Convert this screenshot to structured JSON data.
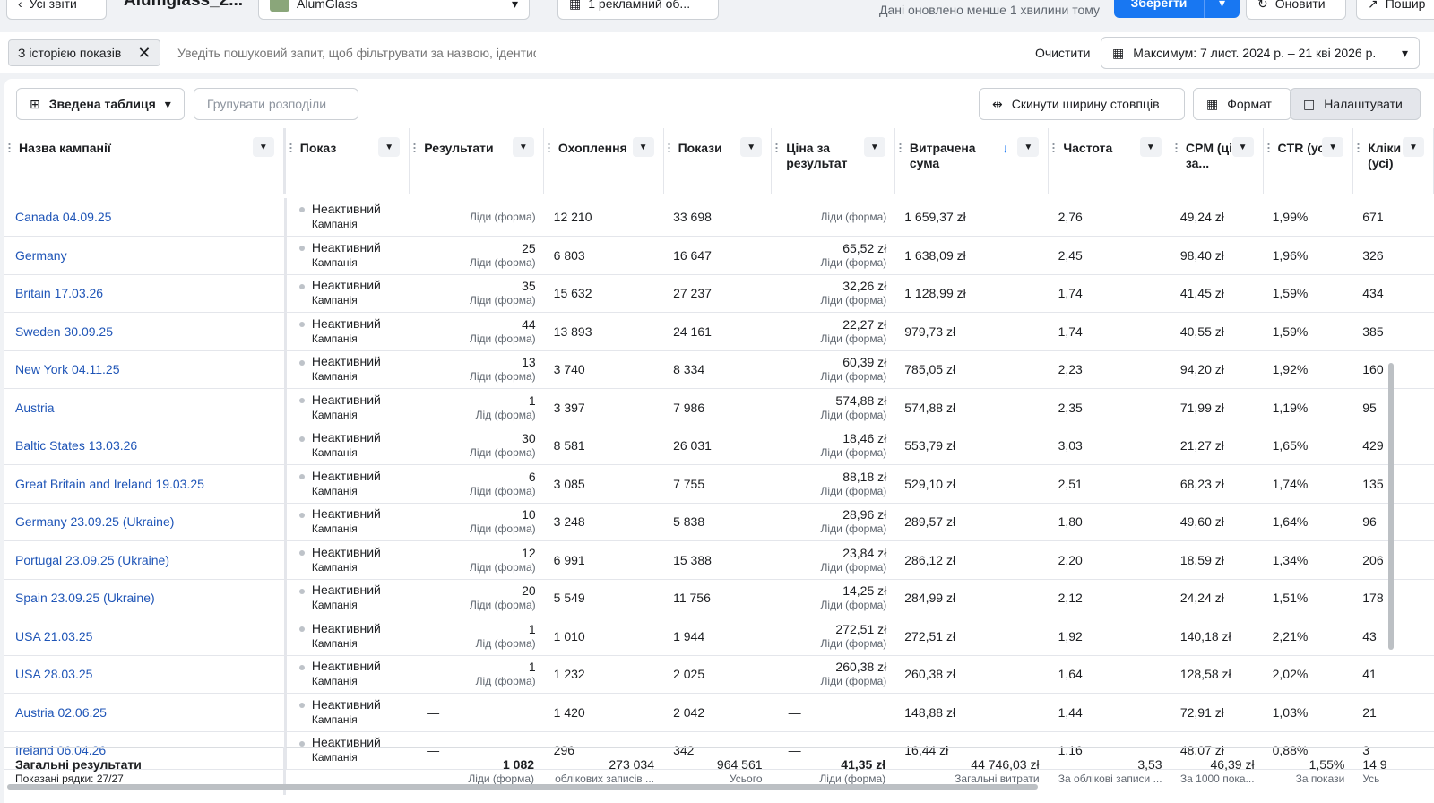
{
  "topbar": {
    "back_label": "Усі звіти",
    "report_title": "Alumglass_2...",
    "account": "AlumGlass",
    "campaigns_selector": "1 рекламний об...",
    "updated_text": "Дані оновлено менше 1 хвилини тому",
    "save_label": "Зберегти",
    "refresh_label": "Оновити",
    "share_label": "Пошир"
  },
  "filters": {
    "chip_label": "З історією показів",
    "search_placeholder": "Уведіть пошуковий запит, щоб фільтрувати за назвою, ідентифікатором або метрикою",
    "clear_label": "Очистити",
    "date_range": "Максимум: 7 лист. 2024 р. – 21 кві 2026 р."
  },
  "toolbar": {
    "pivot_label": "Зведена таблиця",
    "group_label": "Групувати розподіли",
    "reset_width_label": "Скинути ширину стовпців",
    "format_label": "Формат",
    "customize_label": "Налаштувати"
  },
  "columns": [
    {
      "label": "Назва кампанії"
    },
    {
      "label": "Показ"
    },
    {
      "label": "Результати"
    },
    {
      "label": "Охоплення"
    },
    {
      "label": "Покази"
    },
    {
      "label": "Ціна за результат"
    },
    {
      "label": "Витрачена сума",
      "sort_icon": "↓"
    },
    {
      "label": "Частота"
    },
    {
      "label": "CPM (ціна за..."
    },
    {
      "label": "CTR (усі)"
    },
    {
      "label": "Кліки (усі)"
    }
  ],
  "rows": [
    {
      "name": "Canada 04.09.25",
      "status": "Неактивний",
      "type": "Кампанія",
      "results": "",
      "results_unit": "Ліди (форма)",
      "reach": "12 210",
      "impressions": "33 698",
      "cpr": "",
      "cpr_unit": "Ліди (форма)",
      "spent": "1 659,37 zł",
      "freq": "2,76",
      "cpm": "49,24 zł",
      "ctr": "1,99%",
      "clicks": "671"
    },
    {
      "name": "Germany",
      "status": "Неактивний",
      "type": "Кампанія",
      "results": "25",
      "results_unit": "Ліди (форма)",
      "reach": "6 803",
      "impressions": "16 647",
      "cpr": "65,52 zł",
      "cpr_unit": "Ліди (форма)",
      "spent": "1 638,09 zł",
      "freq": "2,45",
      "cpm": "98,40 zł",
      "ctr": "1,96%",
      "clicks": "326"
    },
    {
      "name": "Britain 17.03.26",
      "status": "Неактивний",
      "type": "Кампанія",
      "results": "35",
      "results_unit": "Ліди (форма)",
      "reach": "15 632",
      "impressions": "27 237",
      "cpr": "32,26 zł",
      "cpr_unit": "Ліди (форма)",
      "spent": "1 128,99 zł",
      "freq": "1,74",
      "cpm": "41,45 zł",
      "ctr": "1,59%",
      "clicks": "434"
    },
    {
      "name": "Sweden 30.09.25",
      "status": "Неактивний",
      "type": "Кампанія",
      "results": "44",
      "results_unit": "Ліди (форма)",
      "reach": "13 893",
      "impressions": "24 161",
      "cpr": "22,27 zł",
      "cpr_unit": "Ліди (форма)",
      "spent": "979,73 zł",
      "freq": "1,74",
      "cpm": "40,55 zł",
      "ctr": "1,59%",
      "clicks": "385"
    },
    {
      "name": "New York 04.11.25",
      "status": "Неактивний",
      "type": "Кампанія",
      "results": "13",
      "results_unit": "Ліди (форма)",
      "reach": "3 740",
      "impressions": "8 334",
      "cpr": "60,39 zł",
      "cpr_unit": "Ліди (форма)",
      "spent": "785,05 zł",
      "freq": "2,23",
      "cpm": "94,20 zł",
      "ctr": "1,92%",
      "clicks": "160"
    },
    {
      "name": "Austria",
      "status": "Неактивний",
      "type": "Кампанія",
      "results": "1",
      "results_unit": "Лід (форма)",
      "reach": "3 397",
      "impressions": "7 986",
      "cpr": "574,88 zł",
      "cpr_unit": "Ліди (форма)",
      "spent": "574,88 zł",
      "freq": "2,35",
      "cpm": "71,99 zł",
      "ctr": "1,19%",
      "clicks": "95"
    },
    {
      "name": "Baltic States 13.03.26",
      "status": "Неактивний",
      "type": "Кампанія",
      "results": "30",
      "results_unit": "Ліди (форма)",
      "reach": "8 581",
      "impressions": "26 031",
      "cpr": "18,46 zł",
      "cpr_unit": "Ліди (форма)",
      "spent": "553,79 zł",
      "freq": "3,03",
      "cpm": "21,27 zł",
      "ctr": "1,65%",
      "clicks": "429"
    },
    {
      "name": "Great Britain and Ireland 19.03.25",
      "status": "Неактивний",
      "type": "Кампанія",
      "results": "6",
      "results_unit": "Ліди (форма)",
      "reach": "3 085",
      "impressions": "7 755",
      "cpr": "88,18 zł",
      "cpr_unit": "Ліди (форма)",
      "spent": "529,10 zł",
      "freq": "2,51",
      "cpm": "68,23 zł",
      "ctr": "1,74%",
      "clicks": "135"
    },
    {
      "name": "Germany 23.09.25 (Ukraine)",
      "status": "Неактивний",
      "type": "Кампанія",
      "results": "10",
      "results_unit": "Ліди (форма)",
      "reach": "3 248",
      "impressions": "5 838",
      "cpr": "28,96 zł",
      "cpr_unit": "Ліди (форма)",
      "spent": "289,57 zł",
      "freq": "1,80",
      "cpm": "49,60 zł",
      "ctr": "1,64%",
      "clicks": "96"
    },
    {
      "name": "Portugal 23.09.25 (Ukraine)",
      "status": "Неактивний",
      "type": "Кампанія",
      "results": "12",
      "results_unit": "Ліди (форма)",
      "reach": "6 991",
      "impressions": "15 388",
      "cpr": "23,84 zł",
      "cpr_unit": "Ліди (форма)",
      "spent": "286,12 zł",
      "freq": "2,20",
      "cpm": "18,59 zł",
      "ctr": "1,34%",
      "clicks": "206"
    },
    {
      "name": "Spain 23.09.25 (Ukraine)",
      "status": "Неактивний",
      "type": "Кампанія",
      "results": "20",
      "results_unit": "Ліди (форма)",
      "reach": "5 549",
      "impressions": "11 756",
      "cpr": "14,25 zł",
      "cpr_unit": "Ліди (форма)",
      "spent": "284,99 zł",
      "freq": "2,12",
      "cpm": "24,24 zł",
      "ctr": "1,51%",
      "clicks": "178"
    },
    {
      "name": "USA 21.03.25",
      "status": "Неактивний",
      "type": "Кампанія",
      "results": "1",
      "results_unit": "Лід (форма)",
      "reach": "1 010",
      "impressions": "1 944",
      "cpr": "272,51 zł",
      "cpr_unit": "Ліди (форма)",
      "spent": "272,51 zł",
      "freq": "1,92",
      "cpm": "140,18 zł",
      "ctr": "2,21%",
      "clicks": "43"
    },
    {
      "name": "USA 28.03.25",
      "status": "Неактивний",
      "type": "Кампанія",
      "results": "1",
      "results_unit": "Лід (форма)",
      "reach": "1 232",
      "impressions": "2 025",
      "cpr": "260,38 zł",
      "cpr_unit": "Ліди (форма)",
      "spent": "260,38 zł",
      "freq": "1,64",
      "cpm": "128,58 zł",
      "ctr": "2,02%",
      "clicks": "41"
    },
    {
      "name": "Austria 02.06.25",
      "status": "Неактивний",
      "type": "Кампанія",
      "results": "—",
      "results_unit": "",
      "reach": "1 420",
      "impressions": "2 042",
      "cpr": "—",
      "cpr_unit": "",
      "spent": "148,88 zł",
      "freq": "1,44",
      "cpm": "72,91 zł",
      "ctr": "1,03%",
      "clicks": "21"
    },
    {
      "name": "Ireland 06.04.26",
      "status": "Неактивний",
      "type": "Кампанія",
      "results": "—",
      "results_unit": "",
      "reach": "296",
      "impressions": "342",
      "cpr": "—",
      "cpr_unit": "",
      "spent": "16,44 zł",
      "freq": "1,16",
      "cpm": "48,07 zł",
      "ctr": "0,88%",
      "clicks": "3"
    }
  ],
  "totals": {
    "label": "Загальні результати",
    "rows_shown": "Показані рядки: 27/27",
    "results": "1 082",
    "results_sub": "Ліди (форма)",
    "reach": "273 034",
    "reach_sub": "облікових записів ...",
    "impressions": "964 561",
    "impressions_sub": "Усього",
    "cpr": "41,35 zł",
    "cpr_sub": "Ліди (форма)",
    "spent": "44 746,03 zł",
    "spent_sub": "Загальні витрати",
    "freq": "3,53",
    "freq_sub": "За облікові записи ...",
    "cpm": "46,39 zł",
    "cpm_sub": "За 1000 пока...",
    "ctr": "1,55%",
    "ctr_sub": "За покази",
    "clicks": "14 9",
    "clicks_sub": "Усь"
  },
  "colors": {
    "accent": "#1877f2",
    "link": "#1f55b7",
    "background": "#f0f2f5"
  }
}
